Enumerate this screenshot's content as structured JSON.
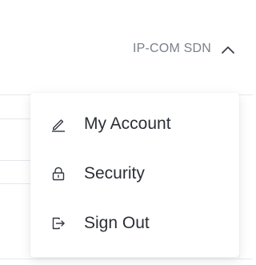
{
  "header": {
    "account_name": "IP-COM SDN"
  },
  "user_menu": {
    "items": [
      {
        "label": "My Account",
        "icon": "pencil-icon"
      },
      {
        "label": "Security",
        "icon": "lock-icon"
      },
      {
        "label": "Sign Out",
        "icon": "sign-out-icon"
      }
    ]
  },
  "colors": {
    "text_primary": "#2b2f36",
    "text_muted": "#7a808a",
    "menu_bg": "#ffffff"
  }
}
